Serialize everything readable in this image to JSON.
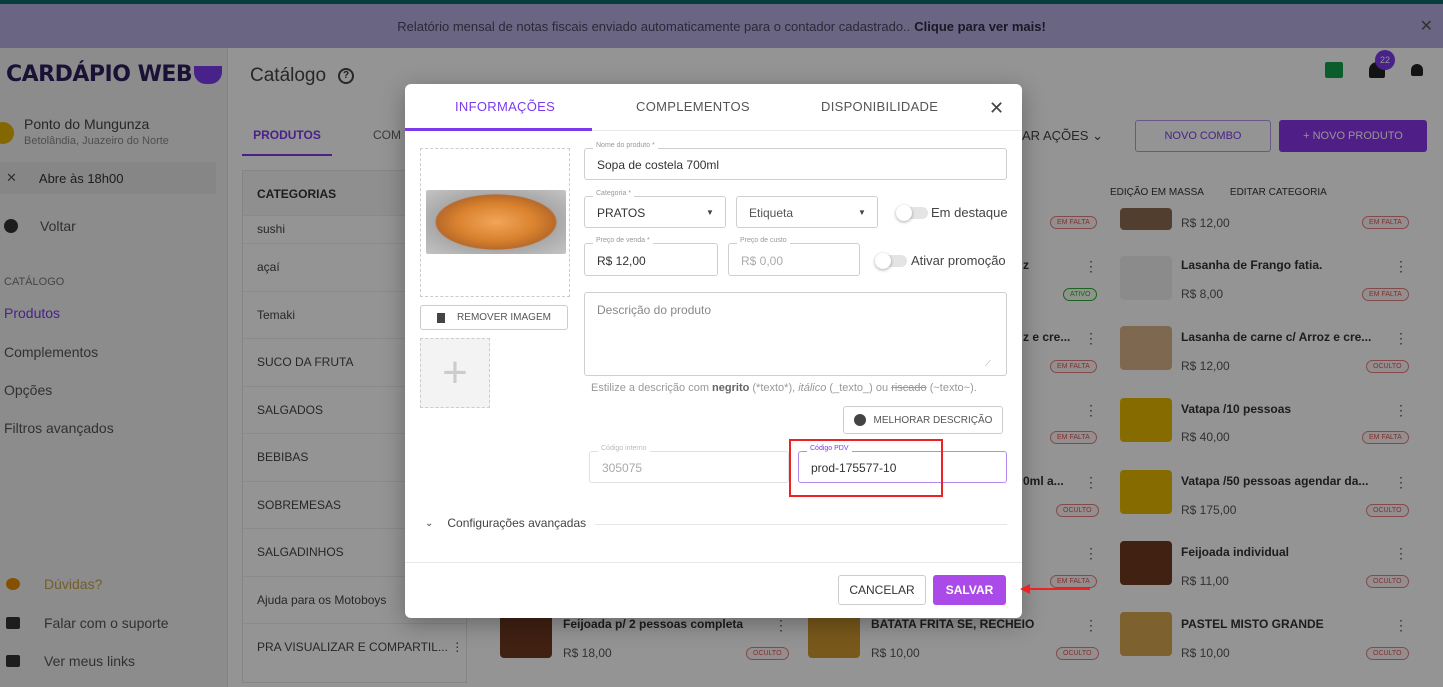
{
  "banner": {
    "text": "Relatório mensal de notas fiscais enviado automaticamente para o contador cadastrado..",
    "link": "Clique para ver mais!",
    "close": "✕"
  },
  "sidebar": {
    "logo": "CARDÁPIO WEB",
    "store_name": "Ponto do Mungunza",
    "store_address": "Betolândia, Juazeiro do Norte",
    "open_close": "✕",
    "open_status": "Abre às 18h00",
    "back": "Voltar",
    "section": "CATÁLOGO",
    "menu": [
      "Produtos",
      "Complementos",
      "Opções",
      "Filtros avançados"
    ],
    "footer": [
      "Dúvidas?",
      "Falar com o suporte",
      "Ver meus links"
    ]
  },
  "header": {
    "title": "Catálogo",
    "help": "?",
    "notif_count": "22"
  },
  "tabs": {
    "produtos": "PRODUTOS",
    "complementos_partial": "COM",
    "acoes_partial": "AR  AÇÕES  ⌄",
    "novo_combo": "NOVO COMBO",
    "novo_produto": "+  NOVO PRODUTO"
  },
  "categories": {
    "header": "CATEGORIAS",
    "items": [
      "sushi",
      "açaí",
      "Temaki",
      "SUCO DA FRUTA",
      "SALGADOS",
      "BEBIBAS",
      "SOBREMESAS",
      "SALGADINHOS",
      "Ajuda para os Motoboys",
      "PRA VISUALIZAR E COMPARTIL...  ⋮"
    ]
  },
  "products_header": {
    "bulk_edit": "EDIÇÃO EM MASSA",
    "edit_category": "EDITAR CATEGORIA"
  },
  "products": [
    {
      "name": "",
      "price": "R$ 12,00",
      "badge": "EM FALTA"
    },
    {
      "name": "Lasanha de Frango fatia.",
      "price": "R$ 8,00",
      "badge": "EM FALTA"
    },
    {
      "name": "Lasanha de carne c/ Arroz e cre...",
      "price": "R$ 12,00",
      "badge": "OCULTO"
    },
    {
      "name": "Vatapa /10 pessoas",
      "price": "R$ 40,00",
      "badge": "EM FALTA"
    },
    {
      "name": "Vatapa /50 pessoas agendar da...",
      "price": "R$ 175,00",
      "badge": "OCULTO"
    },
    {
      "name": "Feijoada individual",
      "price": "R$ 11,00",
      "badge": "OCULTO"
    },
    {
      "name": "PASTEL MISTO GRANDE",
      "price": "R$ 10,00",
      "badge": "OCULTO"
    },
    {
      "name": "Feijoada p/ 2 pessoas completa",
      "price": "R$ 18,00",
      "badge": "OCULTO"
    },
    {
      "name": "BATATA FRITA SE, RECHEIO",
      "price": "R$ 10,00",
      "badge": "OCULTO"
    }
  ],
  "middle_partial": {
    "badges": [
      "EM FALTA",
      "ATIVO",
      "EM FALTA",
      "EM FALTA",
      "OCULTO",
      "EM FALTA"
    ],
    "names": [
      "z",
      "z e cre...",
      "0ml a..."
    ]
  },
  "modal": {
    "tabs": [
      "INFORMAÇÕES",
      "COMPLEMENTOS",
      "DISPONIBILIDADE"
    ],
    "close": "✕",
    "remove_image": "REMOVER IMAGEM",
    "add_symbol": "+",
    "product_name": {
      "label": "Nome do produto *",
      "value": "Sopa de costela 700ml"
    },
    "category": {
      "label": "Categoria *",
      "value": "PRATOS"
    },
    "tag": {
      "placeholder": "Etiqueta"
    },
    "featured": "Em destaque",
    "sale_price": {
      "label": "Preço de venda *",
      "value": "R$  12,00"
    },
    "cost_price": {
      "label": "Preço de custo",
      "value": "R$  0,00"
    },
    "promo": "Ativar promoção",
    "description": {
      "placeholder": "Descrição do produto"
    },
    "hint": {
      "prefix": "Estilize a descrição com ",
      "bold": "negrito",
      "after_bold": " (*texto*), ",
      "italic": "itálico",
      "after_italic": " (_texto_) ou ",
      "strike": "riscado",
      "after_strike": " (~texto~)."
    },
    "improve": "MELHORAR DESCRIÇÃO",
    "internal_code": {
      "label": "Código interno",
      "value": "305075"
    },
    "pdv_code": {
      "label": "Código PDV",
      "value": "prod-175577-10"
    },
    "advanced": "Configurações avançadas",
    "cancel": "CANCELAR",
    "save": "SALVAR"
  },
  "colors": {
    "accent": "#7c3aed",
    "save": "#a94ae9",
    "highlight": "#e22222",
    "banner": "#b9aee3"
  }
}
